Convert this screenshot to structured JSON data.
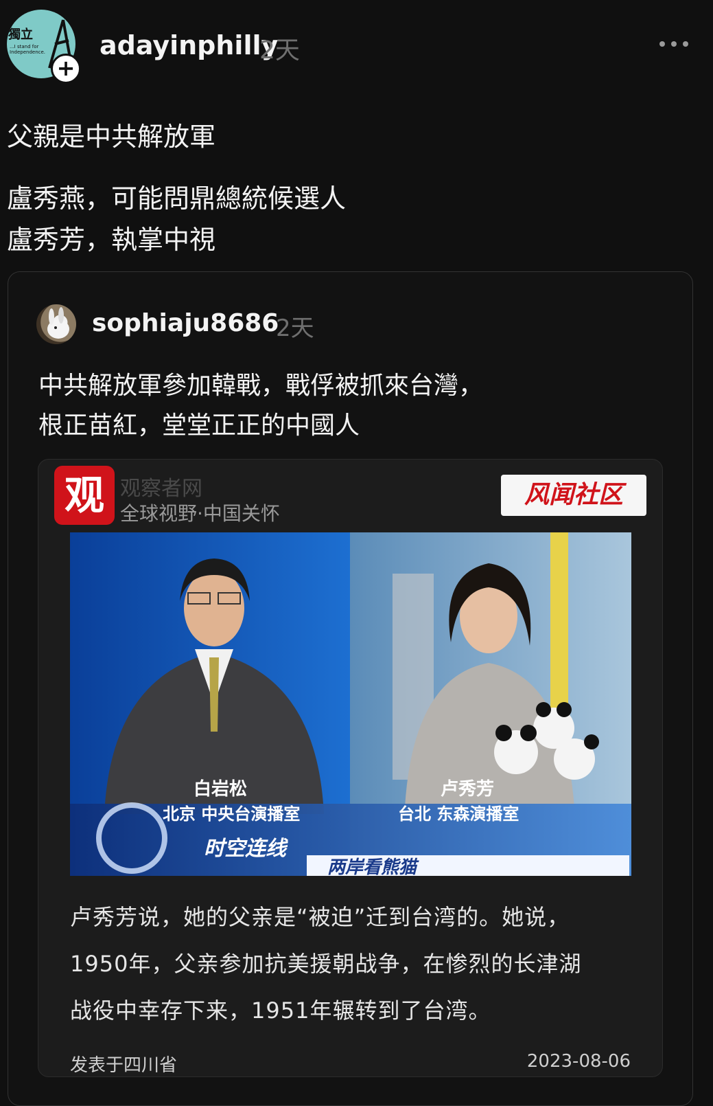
{
  "post": {
    "avatar_logo_text": "獨立",
    "avatar_logo_small": "...I stand for Independence.",
    "username": "adayinphilly",
    "time": "2天",
    "lines": [
      "父親是中共解放軍",
      "盧秀燕，可能問鼎總統候選人",
      "盧秀芳，執掌中視"
    ]
  },
  "quote": {
    "username": "sophiaju8686",
    "time": "2天",
    "lines": [
      "中共解放軍參加韓戰，戰俘被抓來台灣，",
      "根正苗紅，堂堂正正的中國人"
    ]
  },
  "embed": {
    "logo_char": "观",
    "site_name": "观察者网",
    "slogan": "全球视野·中国关怀",
    "badge": "风闻社区",
    "photo": {
      "left_name": "白岩松",
      "left_location": "北京 中央台演播室",
      "right_name": "卢秀芳",
      "right_location": "台北 东森演播室",
      "banner_text": "时空连线",
      "banner_subtext": "两岸看熊猫"
    },
    "text_lines": [
      "卢秀芳说，她的父亲是“被迫”迁到台湾的。她说，",
      "1950年，父亲参加抗美援朝战争，在惨烈的长津湖",
      "战役中幸存下来，1951年辗转到了台湾。"
    ],
    "footer_location": "发表于四川省",
    "footer_date": "2023-08-06"
  },
  "colors": {
    "background": "#101010",
    "muted": "#6f6f6f",
    "accent_red": "#d0131a"
  }
}
